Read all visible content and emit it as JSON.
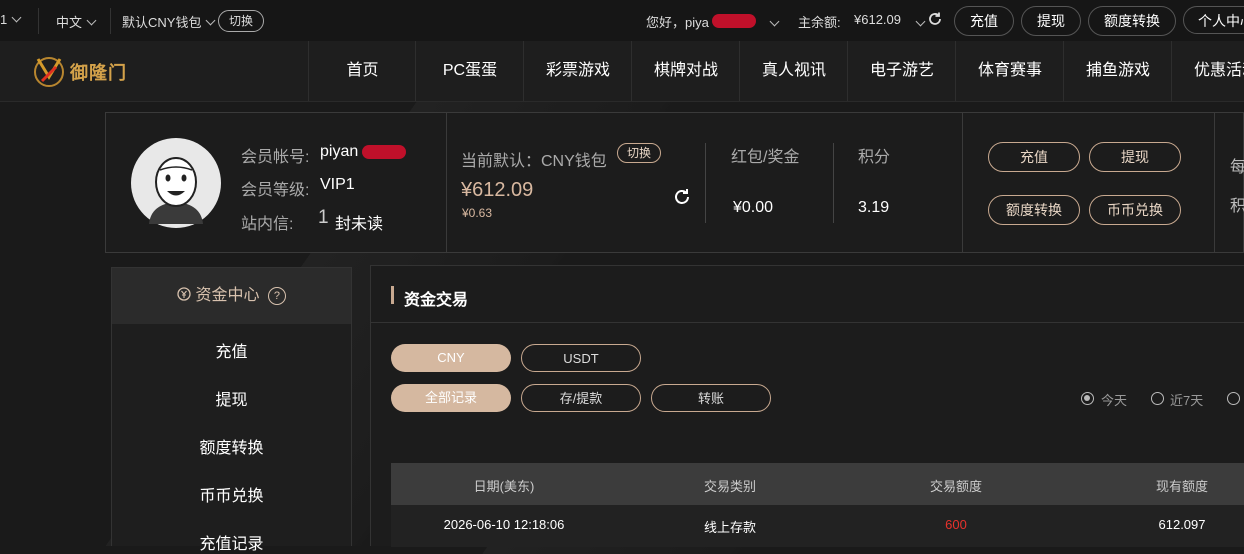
{
  "topbar": {
    "left_partial": "1",
    "language": "中文",
    "wallet_default": "默认CNY钱包",
    "switch_label": "切换",
    "greeting": "您好，piya",
    "balance_label": "主余额:",
    "balance_value": "¥612.09",
    "deposit": "充值",
    "withdraw": "提现",
    "transfer": "额度转换",
    "personal": "个人中心"
  },
  "nav": {
    "logo_text": "御隆门",
    "items": [
      "首页",
      "PC蛋蛋",
      "彩票游戏",
      "棋牌对战",
      "真人视讯",
      "电子游艺",
      "体育赛事",
      "捕鱼游戏",
      "优惠活动"
    ]
  },
  "profile": {
    "account_label": "会员帐号:",
    "account_value": "piyan",
    "level_label": "会员等级:",
    "level_value": "VIP1",
    "message_label": "站内信:",
    "message_count": "1",
    "message_suffix": "封未读",
    "current_label": "当前默认：CNY钱包",
    "switch_label": "切换",
    "main_balance": "¥612.09",
    "sub_balance": "¥0.63",
    "bonus_label": "红包/奖金",
    "bonus_value": "¥0.00",
    "points_label": "积分",
    "points_value": "3.19",
    "btn_deposit": "充值",
    "btn_withdraw": "提现",
    "btn_transfer": "额度转换",
    "btn_exchange": "币币兑换",
    "right_partial_1": "每",
    "right_partial_2": "积"
  },
  "sidebar": {
    "title": "资金中心",
    "items": [
      "充值",
      "提现",
      "额度转换",
      "币币兑换",
      "充值记录"
    ]
  },
  "main": {
    "title": "资金交易",
    "currency_tabs": [
      "CNY",
      "USDT"
    ],
    "filter_tabs": [
      "全部记录",
      "存/提款",
      "转账"
    ],
    "date_options": [
      "今天",
      "近7天"
    ],
    "columns": [
      "日期(美东)",
      "交易类别",
      "交易额度",
      "现有额度"
    ],
    "rows": [
      {
        "date": "2026-06-10 12:18:06",
        "type": "线上存款",
        "amount": "600",
        "balance": "612.097"
      }
    ]
  },
  "colors": {
    "accent": "#d5b8a0",
    "amount_red": "#e8322c",
    "redaction": "#c0102a"
  }
}
